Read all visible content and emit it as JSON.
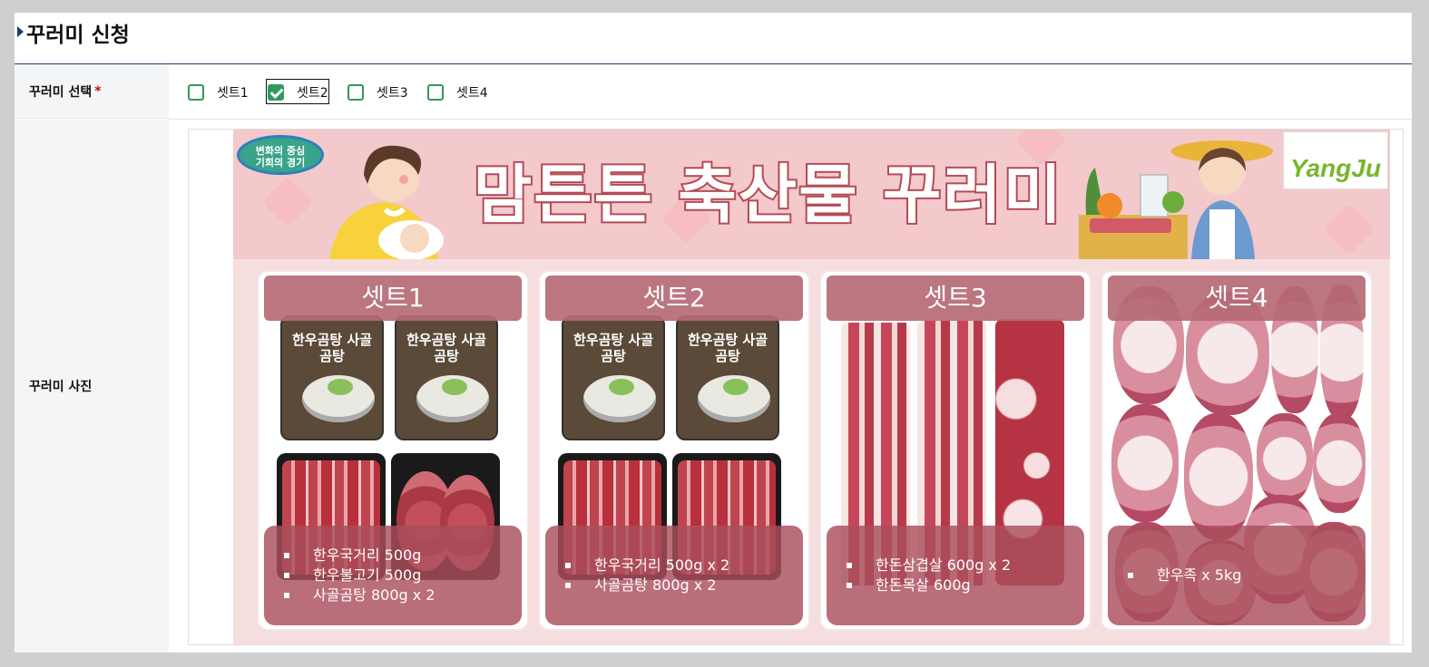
{
  "page": {
    "title": "꾸러미 신청"
  },
  "form": {
    "select_label": "꾸러미 선택",
    "required_mark": "*",
    "options": [
      {
        "label": "셋트1",
        "checked": false
      },
      {
        "label": "셋트2",
        "checked": true
      },
      {
        "label": "셋트3",
        "checked": false
      },
      {
        "label": "셋트4",
        "checked": false
      }
    ],
    "photo_label": "꾸러미 사진"
  },
  "banner": {
    "badge_line1": "변화의 중심",
    "badge_line2": "기회의 경기",
    "title": "맘튼튼 축산물 꾸러미",
    "logo": "YangJu",
    "sets": [
      {
        "name": "셋트1",
        "items": [
          "한우국거리 500g",
          "한우불고기 500g",
          "사골곰탕 800g x 2"
        ]
      },
      {
        "name": "셋트2",
        "items": [
          "한우국거리 500g x 2",
          "사골곰탕 800g x 2"
        ]
      },
      {
        "name": "셋트3",
        "items": [
          "한돈삼겹살 600g x 2",
          "한돈목살 600g"
        ]
      },
      {
        "name": "셋트4",
        "items": [
          "한우족 x 5kg"
        ]
      }
    ],
    "soup_pack_text": "한우곰탕 사골곰탕"
  },
  "colors": {
    "accent": "#1f3d6b",
    "checkbox": "#2f9a5d",
    "banner_pink": "#f3c9cb",
    "set_overlay": "#b66b76"
  }
}
